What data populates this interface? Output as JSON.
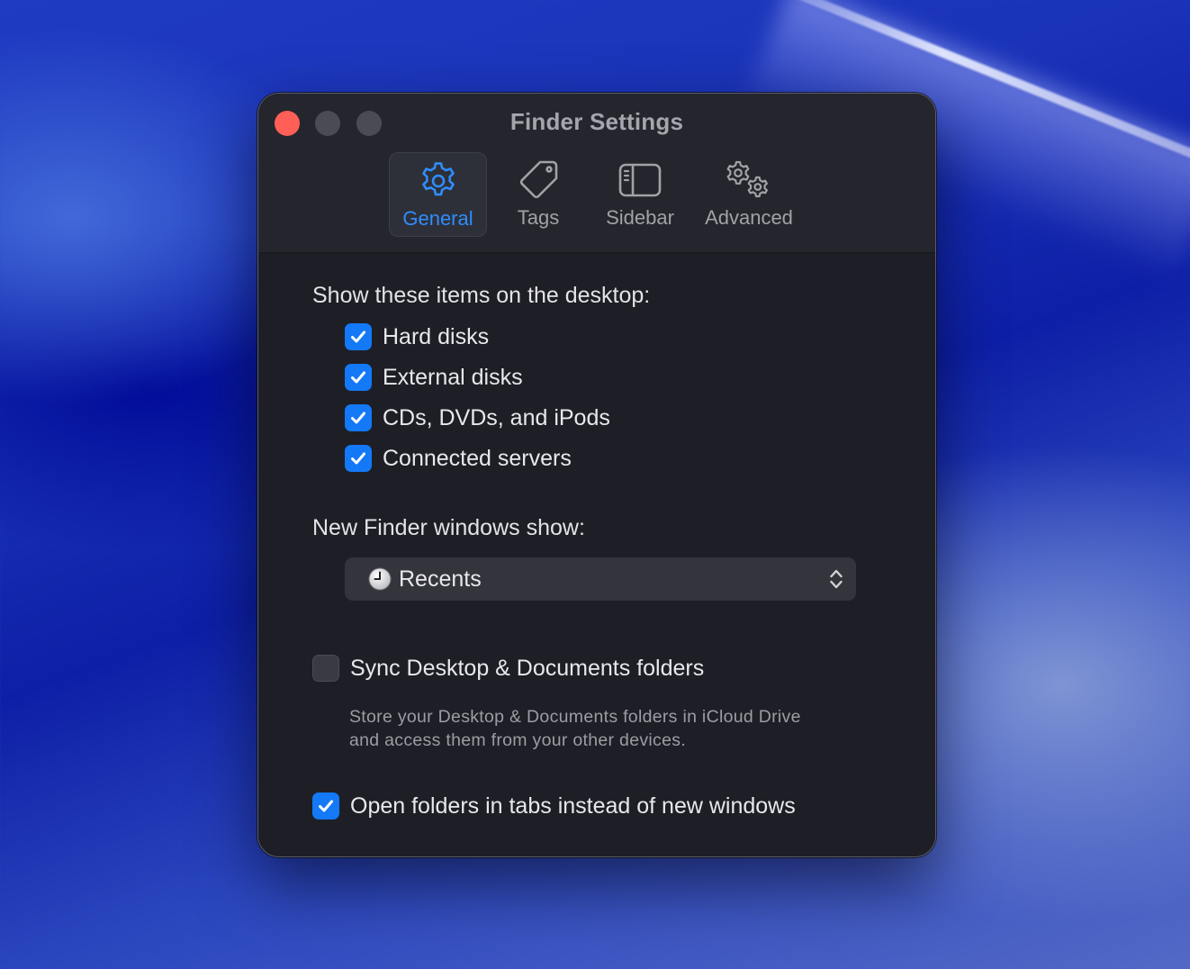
{
  "window": {
    "title": "Finder Settings"
  },
  "tabs": [
    {
      "label": "General",
      "icon": "gear-icon",
      "active": true
    },
    {
      "label": "Tags",
      "icon": "tag-icon",
      "active": false
    },
    {
      "label": "Sidebar",
      "icon": "sidebar-icon",
      "active": false
    },
    {
      "label": "Advanced",
      "icon": "gears-icon",
      "active": false
    }
  ],
  "desktop_items": {
    "heading": "Show these items on the desktop:",
    "items": [
      {
        "label": "Hard disks",
        "checked": true
      },
      {
        "label": "External disks",
        "checked": true
      },
      {
        "label": "CDs, DVDs, and iPods",
        "checked": true
      },
      {
        "label": "Connected servers",
        "checked": true
      }
    ]
  },
  "new_windows": {
    "heading": "New Finder windows show:",
    "selected": "Recents",
    "icon": "clock-icon"
  },
  "sync": {
    "label": "Sync Desktop & Documents folders",
    "checked": false,
    "description": "Store your Desktop & Documents folders in iCloud Drive and access them from your other devices."
  },
  "open_tabs": {
    "label": "Open folders in tabs instead of new windows",
    "checked": true
  },
  "colors": {
    "accent": "#1479f6",
    "active_tab_text": "#2f8dfd",
    "close_button": "#ff5f57",
    "window_bg": "#1e1f26"
  }
}
